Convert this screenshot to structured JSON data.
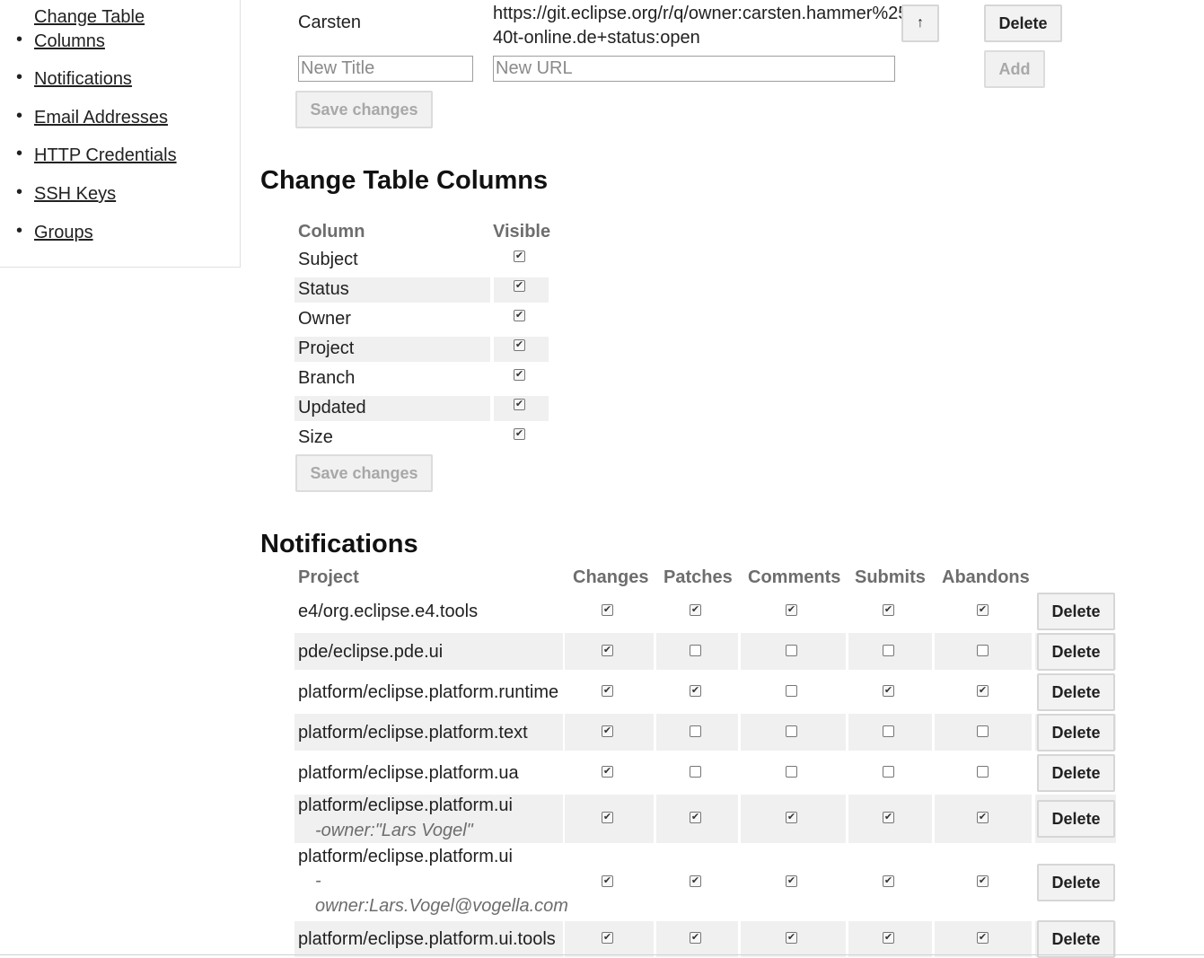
{
  "sidebar": {
    "items": [
      {
        "label": "Change Table Columns"
      },
      {
        "label": "Notifications"
      },
      {
        "label": "Email Addresses"
      },
      {
        "label": "HTTP Credentials"
      },
      {
        "label": "SSH Keys"
      },
      {
        "label": "Groups"
      }
    ]
  },
  "menu": {
    "row": {
      "name": "Carsten",
      "url": "https://git.eclipse.org/r/q/owner:carsten.hammer%2540t-online.de+status:open",
      "url_line1": "https://git.eclipse.org/r/q/owner:carsten.hammer%25",
      "url_line2": "40t-online.de+status:open",
      "move_up_label": "↑",
      "delete_label": "Delete"
    },
    "new_title_placeholder": "New Title",
    "new_url_placeholder": "New URL",
    "add_label": "Add",
    "save_label": "Save changes"
  },
  "columns": {
    "title": "Change Table Columns",
    "header_column": "Column",
    "header_visible": "Visible",
    "rows": [
      {
        "name": "Subject",
        "visible": true
      },
      {
        "name": "Status",
        "visible": true
      },
      {
        "name": "Owner",
        "visible": true
      },
      {
        "name": "Project",
        "visible": true
      },
      {
        "name": "Branch",
        "visible": true
      },
      {
        "name": "Updated",
        "visible": true
      },
      {
        "name": "Size",
        "visible": true
      }
    ],
    "save_label": "Save changes"
  },
  "notifications": {
    "title": "Notifications",
    "headers": {
      "project": "Project",
      "changes": "Changes",
      "patches": "Patches",
      "comments": "Comments",
      "submits": "Submits",
      "abandons": "Abandons"
    },
    "delete_label": "Delete",
    "rows": [
      {
        "project": "e4/org.eclipse.e4.tools",
        "filter": "",
        "changes": true,
        "patches": true,
        "comments": true,
        "submits": true,
        "abandons": true
      },
      {
        "project": "pde/eclipse.pde.ui",
        "filter": "",
        "changes": true,
        "patches": false,
        "comments": false,
        "submits": false,
        "abandons": false
      },
      {
        "project": "platform/eclipse.platform.runtime",
        "filter": "",
        "changes": true,
        "patches": true,
        "comments": false,
        "submits": true,
        "abandons": true
      },
      {
        "project": "platform/eclipse.platform.text",
        "filter": "",
        "changes": true,
        "patches": false,
        "comments": false,
        "submits": false,
        "abandons": false
      },
      {
        "project": "platform/eclipse.platform.ua",
        "filter": "",
        "changes": true,
        "patches": false,
        "comments": false,
        "submits": false,
        "abandons": false
      },
      {
        "project": "platform/eclipse.platform.ui",
        "filter": "-owner:\"Lars Vogel\"",
        "changes": true,
        "patches": true,
        "comments": true,
        "submits": true,
        "abandons": true
      },
      {
        "project": "platform/eclipse.platform.ui",
        "filter_dash": "-",
        "filter": "owner:Lars.Vogel@vogella.com",
        "changes": true,
        "patches": true,
        "comments": true,
        "submits": true,
        "abandons": true
      },
      {
        "project": "platform/eclipse.platform.ui.tools",
        "filter": "",
        "changes": true,
        "patches": true,
        "comments": true,
        "submits": true,
        "abandons": true
      }
    ]
  }
}
